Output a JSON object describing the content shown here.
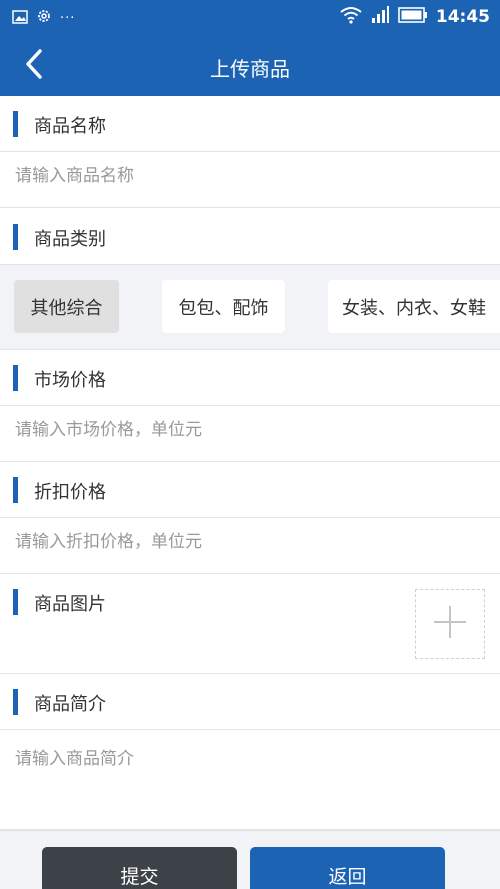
{
  "status_bar": {
    "time": "14:45",
    "overflow": "···",
    "icons": [
      "image-icon",
      "settings-icon",
      "wifi-icon",
      "signal-icon",
      "battery-icon"
    ]
  },
  "header": {
    "title": "上传商品",
    "back_icon": "chevron-left-icon"
  },
  "form": {
    "name": {
      "label": "商品名称",
      "placeholder": "请输入商品名称"
    },
    "category": {
      "label": "商品类别",
      "options": [
        "其他综合",
        "包包、配饰",
        "女装、内衣、女鞋"
      ],
      "selected": "其他综合"
    },
    "market_price": {
      "label": "市场价格",
      "placeholder": "请输入市场价格，单位元"
    },
    "discount_price": {
      "label": "折扣价格",
      "placeholder": "请输入折扣价格，单位元"
    },
    "image": {
      "label": "商品图片",
      "add_icon": "plus-icon"
    },
    "description": {
      "label": "商品简介",
      "placeholder": "请输入商品简介"
    }
  },
  "actions": {
    "submit_label": "提交",
    "back_label": "返回"
  },
  "colors": {
    "primary": "#1c63b4",
    "dark_button": "#3d4148",
    "section_bg": "#f1f3f7",
    "selected_chip": "#e0e0e0"
  }
}
